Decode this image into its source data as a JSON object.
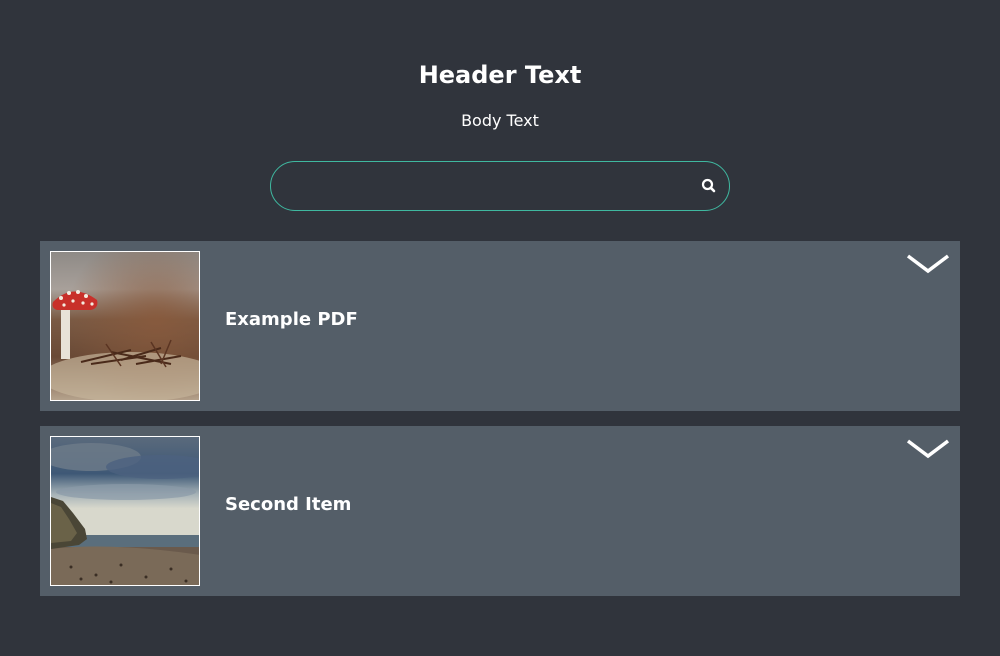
{
  "header": {
    "title": "Header Text",
    "body": "Body Text"
  },
  "search": {
    "value": "",
    "icon": "search-icon"
  },
  "items": [
    {
      "title": "Example PDF",
      "thumbnail": "mushroom-photo",
      "toggle_icon": "chevron-down-icon"
    },
    {
      "title": "Second Item",
      "thumbnail": "coastline-photo",
      "toggle_icon": "chevron-down-icon"
    }
  ],
  "colors": {
    "background": "#30343c",
    "card": "#545e68",
    "search_border": "#3fb8a0",
    "text": "#ffffff"
  }
}
